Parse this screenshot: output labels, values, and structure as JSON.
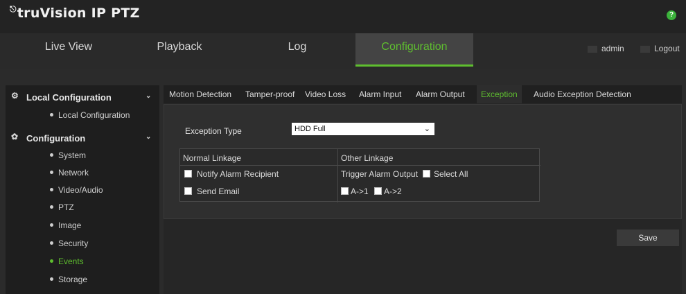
{
  "app": {
    "logo_text": "truVision IP PTZ",
    "help_glyph": "?"
  },
  "nav": {
    "tabs": [
      {
        "label": "Live View"
      },
      {
        "label": "Playback"
      },
      {
        "label": "Log"
      },
      {
        "label": "Configuration",
        "active": true
      }
    ],
    "user": "admin",
    "logout": "Logout"
  },
  "sidebar": {
    "sections": [
      {
        "title": "Local Configuration",
        "icon": "gear-icon",
        "items": [
          "Local Configuration"
        ]
      },
      {
        "title": "Configuration",
        "icon": "wrench-icon",
        "items": [
          "System",
          "Network",
          "Video/Audio",
          "PTZ",
          "Image",
          "Security",
          "Events",
          "Storage"
        ]
      }
    ],
    "active_item": "Events"
  },
  "subtabs": [
    "Motion Detection",
    "Tamper-proof",
    "Video Loss",
    "Alarm Input",
    "Alarm Output",
    "Exception",
    "Audio Exception Detection"
  ],
  "active_subtab": "Exception",
  "form": {
    "exception_type_label": "Exception Type",
    "exception_type_value": "HDD Full",
    "normal_linkage_header": "Normal Linkage",
    "other_linkage_header": "Other Linkage",
    "notify_alarm_recipient": "Notify Alarm Recipient",
    "send_email": "Send Email",
    "trigger_alarm_output": "Trigger Alarm Output",
    "select_all": "Select All",
    "outputs": [
      "A->1",
      "A->2"
    ]
  },
  "save_label": "Save",
  "colors": {
    "accent": "#5fbf2f",
    "bg": "#2b2b2b"
  }
}
